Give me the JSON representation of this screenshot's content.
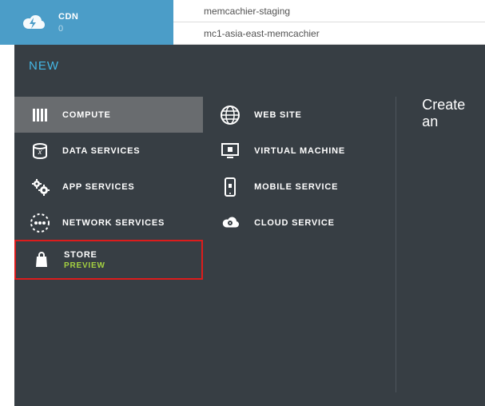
{
  "top": {
    "cdn": {
      "label": "CDN",
      "count": "0"
    },
    "items": [
      "memcachier-staging",
      "mc1-asia-east-memcachier"
    ]
  },
  "new_label": "NEW",
  "categories": [
    {
      "label": "COMPUTE"
    },
    {
      "label": "DATA SERVICES"
    },
    {
      "label": "APP SERVICES"
    },
    {
      "label": "NETWORK SERVICES"
    },
    {
      "label": "STORE",
      "sub": "PREVIEW"
    }
  ],
  "services": [
    {
      "label": "WEB SITE"
    },
    {
      "label": "VIRTUAL MACHINE"
    },
    {
      "label": "MOBILE SERVICE"
    },
    {
      "label": "CLOUD SERVICE"
    }
  ],
  "heading": "Create an"
}
